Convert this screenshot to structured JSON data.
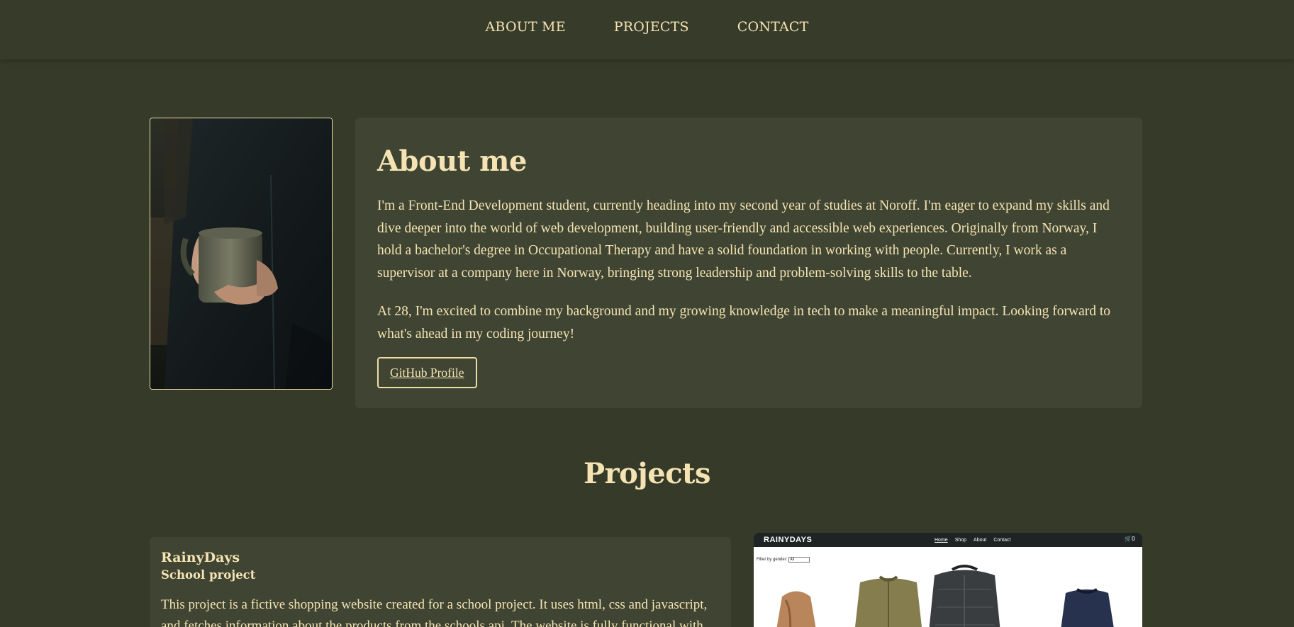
{
  "nav": {
    "items": [
      {
        "label": "ABOUT ME"
      },
      {
        "label": "PROJECTS"
      },
      {
        "label": "CONTACT"
      }
    ]
  },
  "about": {
    "title": "About me",
    "paragraphs": [
      "I'm a Front-End Development student, currently heading into my second year of studies at Noroff. I'm eager to expand my skills and dive deeper into the world of web development, building user-friendly and accessible web experiences. Originally from Norway, I hold a bachelor's degree in Occupational Therapy and have a solid foundation in working with people. Currently, I work as a supervisor at a company here in Norway, bringing strong leadership and problem-solving skills to the table.",
      "At 28, I'm excited to combine my background and my growing knowledge in tech to make a meaningful impact. Looking forward to what's ahead in my coding journey!"
    ],
    "button_label": "GitHub Profile"
  },
  "projects": {
    "title": "Projects",
    "items": [
      {
        "name": "RainyDays",
        "subtitle": "School project",
        "description": "This project is a fictive shopping website created for a school project. It uses html, css and javascript, and fetches information about the products from the schools api. The website is fully functional with adding",
        "screenshot": {
          "logo": "RAINYDAYS",
          "links": [
            "Home",
            "Shop",
            "About",
            "Contact"
          ],
          "cart_count": "0",
          "filter_label": "Filter by gender:",
          "filter_value": "All"
        }
      }
    ]
  },
  "colors": {
    "background": "#363a29",
    "card": "#3f4532",
    "text": "#f5e3b3"
  }
}
